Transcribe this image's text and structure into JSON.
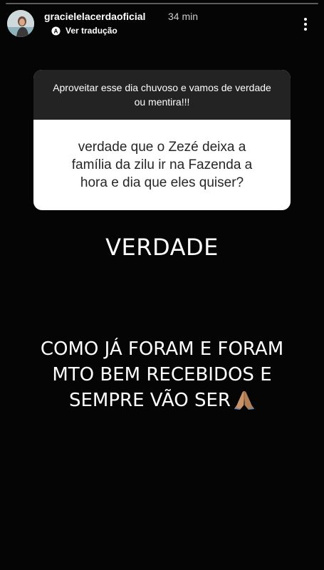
{
  "story": {
    "progress_percent": 0
  },
  "header": {
    "username": "gracielelacerdaoficial",
    "time": "34 min",
    "translate_label": "Ver tradução"
  },
  "question_sticker": {
    "prompt": "Aproveitar esse dia chuvoso e vamos de verdade ou mentira!!!",
    "answer": "verdade que  o Zezé deixa a\nfamília da zilu ir na Fazenda a\nhora e dia que eles quiser?"
  },
  "reply": {
    "title": "VERDADE",
    "text": "COMO JÁ FORAM E FORAM\nMTO BEM RECEBIDOS E\nSEMPRE VÃO SER",
    "emoji": "folded-hands-icon"
  },
  "colors": {
    "background": "#050505",
    "sticker_header": "#232323",
    "sticker_body": "#ffffff",
    "text_primary": "#ffffff"
  }
}
